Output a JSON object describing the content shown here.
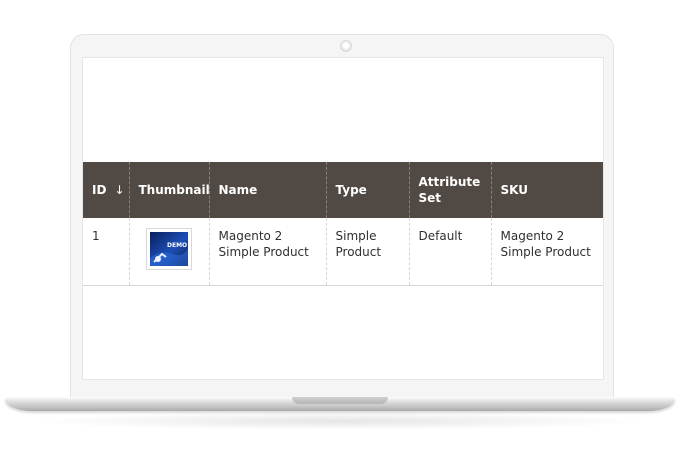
{
  "grid": {
    "columns": [
      {
        "label": "ID",
        "sort_icon": "arrow-down-icon",
        "sort_glyph": "↓"
      },
      {
        "label": "Thumbnail"
      },
      {
        "label": "Name"
      },
      {
        "label": "Type"
      },
      {
        "label": "Attribute Set"
      },
      {
        "label": "SKU"
      }
    ],
    "rows": [
      {
        "id": "1",
        "thumbnail_label": "DEMO",
        "name": "Magento 2 Simple Product",
        "type": "Simple Product",
        "attribute_set": "Default",
        "sku": "Magento 2 Simple Product"
      }
    ]
  },
  "colors": {
    "header_bg": "#514943",
    "header_text": "#ffffff",
    "cell_text": "#303030"
  }
}
